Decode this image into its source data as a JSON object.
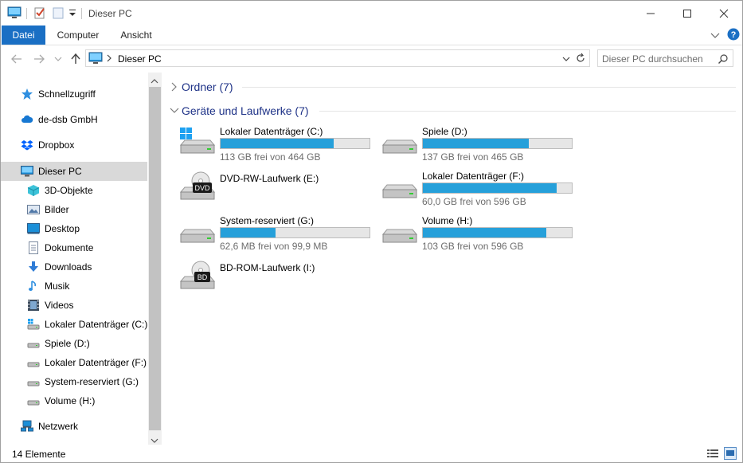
{
  "window": {
    "title": "Dieser PC"
  },
  "ribbon": {
    "tabs": [
      {
        "label": "Datei",
        "active": true
      },
      {
        "label": "Computer",
        "active": false
      },
      {
        "label": "Ansicht",
        "active": false
      }
    ]
  },
  "address": {
    "path": "Dieser PC"
  },
  "search": {
    "placeholder": "Dieser PC durchsuchen"
  },
  "sidebar": {
    "items": [
      {
        "label": "Schnellzugriff",
        "icon": "star-icon"
      },
      {
        "label": "de-dsb GmbH",
        "icon": "cloud-icon"
      },
      {
        "label": "Dropbox",
        "icon": "dropbox-icon"
      },
      {
        "label": "Dieser PC",
        "icon": "monitor-icon"
      },
      {
        "label": "3D-Objekte",
        "icon": "cube-icon"
      },
      {
        "label": "Bilder",
        "icon": "pictures-icon"
      },
      {
        "label": "Desktop",
        "icon": "desktop-icon"
      },
      {
        "label": "Dokumente",
        "icon": "documents-icon"
      },
      {
        "label": "Downloads",
        "icon": "download-icon"
      },
      {
        "label": "Musik",
        "icon": "music-icon"
      },
      {
        "label": "Videos",
        "icon": "video-icon"
      },
      {
        "label": "Lokaler Datenträger (C:)",
        "icon": "windows-drive-icon"
      },
      {
        "label": "Spiele (D:)",
        "icon": "drive-icon"
      },
      {
        "label": "Lokaler Datenträger (F:)",
        "icon": "drive-icon"
      },
      {
        "label": "System-reserviert (G:)",
        "icon": "drive-icon"
      },
      {
        "label": "Volume (H:)",
        "icon": "drive-icon"
      },
      {
        "label": "Netzwerk",
        "icon": "network-icon"
      }
    ]
  },
  "content": {
    "groups": [
      {
        "label": "Ordner (7)",
        "expanded": false
      },
      {
        "label": "Geräte und Laufwerke (7)",
        "expanded": true
      }
    ],
    "drives": [
      {
        "name": "Lokaler Datenträger (C:)",
        "free": "113 GB frei von 464 GB",
        "used_fraction": 0.76,
        "kind": "windows"
      },
      {
        "name": "Spiele (D:)",
        "free": "137 GB frei von 465 GB",
        "used_fraction": 0.71,
        "kind": "hdd"
      },
      {
        "name": "DVD-RW-Laufwerk (E:)",
        "free": "",
        "used_fraction": null,
        "kind": "dvd",
        "badge": "DVD"
      },
      {
        "name": "Lokaler Datenträger (F:)",
        "free": "60,0 GB frei von 596 GB",
        "used_fraction": 0.9,
        "kind": "hdd"
      },
      {
        "name": "System-reserviert (G:)",
        "free": "62,6 MB frei von 99,9 MB",
        "used_fraction": 0.37,
        "kind": "hdd"
      },
      {
        "name": "Volume (H:)",
        "free": "103 GB frei von 596 GB",
        "used_fraction": 0.83,
        "kind": "hdd"
      },
      {
        "name": "BD-ROM-Laufwerk (I:)",
        "free": "",
        "used_fraction": null,
        "kind": "bd",
        "badge": "BD"
      }
    ]
  },
  "status": {
    "count": "14 Elemente"
  },
  "colors": {
    "accent": "#1a6fc4",
    "bar": "#26a0da",
    "group_header": "#1e3287"
  }
}
